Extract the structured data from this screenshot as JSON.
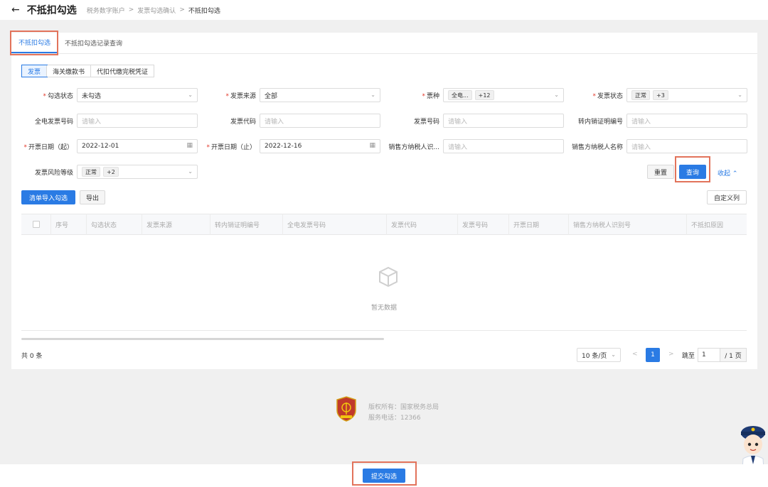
{
  "header": {
    "title": "不抵扣勾选",
    "breadcrumbs": [
      "税务数字账户",
      "发票勾选确认",
      "不抵扣勾选"
    ]
  },
  "tabs": [
    "不抵扣勾选",
    "不抵扣勾选记录查询"
  ],
  "segments": [
    "发票",
    "海关缴款书",
    "代扣代缴完税凭证"
  ],
  "form": {
    "check_status": {
      "label": "勾选状态",
      "value": "未勾选"
    },
    "invoice_source": {
      "label": "发票来源",
      "value": "全部"
    },
    "ticket_type": {
      "label": "票种",
      "tag1": "全电...",
      "tag2": "+12"
    },
    "invoice_status": {
      "label": "发票状态",
      "tag1": "正常",
      "tag2": "+3"
    },
    "full_invoice_no": {
      "label": "全电发票号码",
      "placeholder": "请输入"
    },
    "invoice_code": {
      "label": "发票代码",
      "placeholder": "请输入"
    },
    "invoice_no": {
      "label": "发票号码",
      "placeholder": "请输入"
    },
    "transfer_cert_no": {
      "label": "转内销证明编号",
      "placeholder": "请输入"
    },
    "date_start": {
      "label": "开票日期（起）",
      "value": "2022-12-01"
    },
    "date_end": {
      "label": "开票日期（止）",
      "value": "2022-12-16"
    },
    "seller_tax_id": {
      "label": "销售方纳税人识...",
      "placeholder": "请输入"
    },
    "seller_name": {
      "label": "销售方纳税人名称",
      "placeholder": "请输入"
    },
    "risk_level": {
      "label": "发票风险等级",
      "tag1": "正常",
      "tag2": "+2"
    }
  },
  "buttons": {
    "reset": "重置",
    "query": "查询",
    "collapse": "收起",
    "import": "清单导入勾选",
    "export": "导出",
    "custom_columns": "自定义列",
    "submit": "提交勾选"
  },
  "table": {
    "columns": [
      "序号",
      "勾选状态",
      "发票来源",
      "转内销证明编号",
      "全电发票号码",
      "发票代码",
      "发票号码",
      "开票日期",
      "销售方纳税人识别号",
      "不抵扣原因"
    ],
    "empty_text": "暂无数据"
  },
  "pagination": {
    "total": "共 0 条",
    "page_size": "10 条/页",
    "current": "1",
    "jump_label": "跳至",
    "jump_value": "1",
    "pages": "/ 1 页"
  },
  "footer": {
    "copyright": "版权所有：国家税务总局",
    "phone": "服务电话：12366"
  },
  "colors": {
    "primary": "#2a7be4",
    "highlight": "#e2735b",
    "required": "#e2392b"
  }
}
